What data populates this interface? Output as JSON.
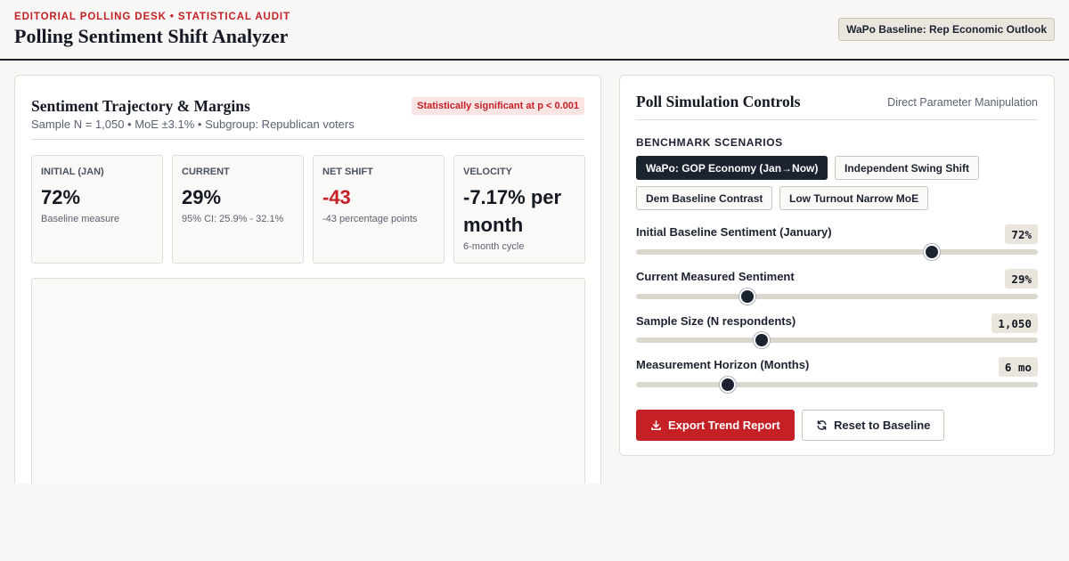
{
  "header": {
    "eyebrow": "EDITORIAL POLLING DESK • STATISTICAL AUDIT",
    "title": "Polling Sentiment Shift Analyzer",
    "baseline_badge": "WaPo Baseline: Rep Economic Outlook"
  },
  "trajectory": {
    "title": "Sentiment Trajectory & Margins",
    "subtitle": "Sample N = 1,050 • MoE ±3.1% • Subgroup: Republican voters",
    "significance": "Statistically significant at p < 0.001",
    "metrics": [
      {
        "label": "INITIAL (JAN)",
        "value": "72%",
        "note": "Baseline measure"
      },
      {
        "label": "CURRENT",
        "value": "29%",
        "note": "95% CI: 25.9% - 32.1%"
      },
      {
        "label": "NET SHIFT",
        "value": "-43",
        "note": "-43 percentage points"
      },
      {
        "label": "VELOCITY",
        "value": "-7.17% per month",
        "note": "6-month cycle"
      }
    ]
  },
  "controls": {
    "title": "Poll Simulation Controls",
    "subtitle": "Direct Parameter Manipulation",
    "scenarios_heading": "BENCHMARK SCENARIOS",
    "scenarios": [
      {
        "label": "WaPo: GOP Economy (Jan→Now)",
        "active": true
      },
      {
        "label": "Independent Swing Shift",
        "active": false
      },
      {
        "label": "Dem Baseline Contrast",
        "active": false
      },
      {
        "label": "Low Turnout Narrow MoE",
        "active": false
      }
    ],
    "sliders": [
      {
        "label": "Initial Baseline Sentiment (January)",
        "display": "72%",
        "level": 0.736
      },
      {
        "label": "Current Measured Sentiment",
        "display": "29%",
        "level": 0.277
      },
      {
        "label": "Sample Size (N respondents)",
        "display": "1,050",
        "level": 0.313
      },
      {
        "label": "Measurement Horizon (Months)",
        "display": "6 mo",
        "level": 0.228
      }
    ],
    "export_label": "Export Trend Report",
    "reset_label": "Reset to Baseline"
  },
  "colors": {
    "accent_red": "#c42025",
    "navy": "#1b2230",
    "badge_bg": "#ebe6dd",
    "significance_bg": "#fbe4e4"
  },
  "icons": {
    "export": "download-icon",
    "reset": "refresh-icon"
  }
}
